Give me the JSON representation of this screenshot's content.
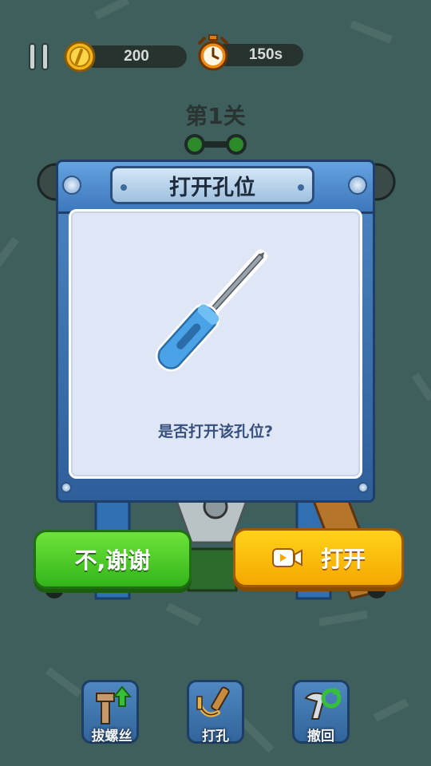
{
  "hud": {
    "coins": "200",
    "time": "150s"
  },
  "level": {
    "title": "第1关"
  },
  "dialog": {
    "title": "打开孔位",
    "question": "是否打开该孔位?",
    "no_label": "不,谢谢",
    "open_label": "打开"
  },
  "tools": [
    {
      "label": "拔螺丝",
      "icon": "pull-screw-icon"
    },
    {
      "label": "打孔",
      "icon": "drill-hole-icon"
    },
    {
      "label": "撤回",
      "icon": "undo-icon"
    }
  ],
  "colors": {
    "background": "#3e5f5b",
    "panel_blue": "#3d78bc",
    "no_button": "#33b51a",
    "open_button": "#f5a800"
  }
}
